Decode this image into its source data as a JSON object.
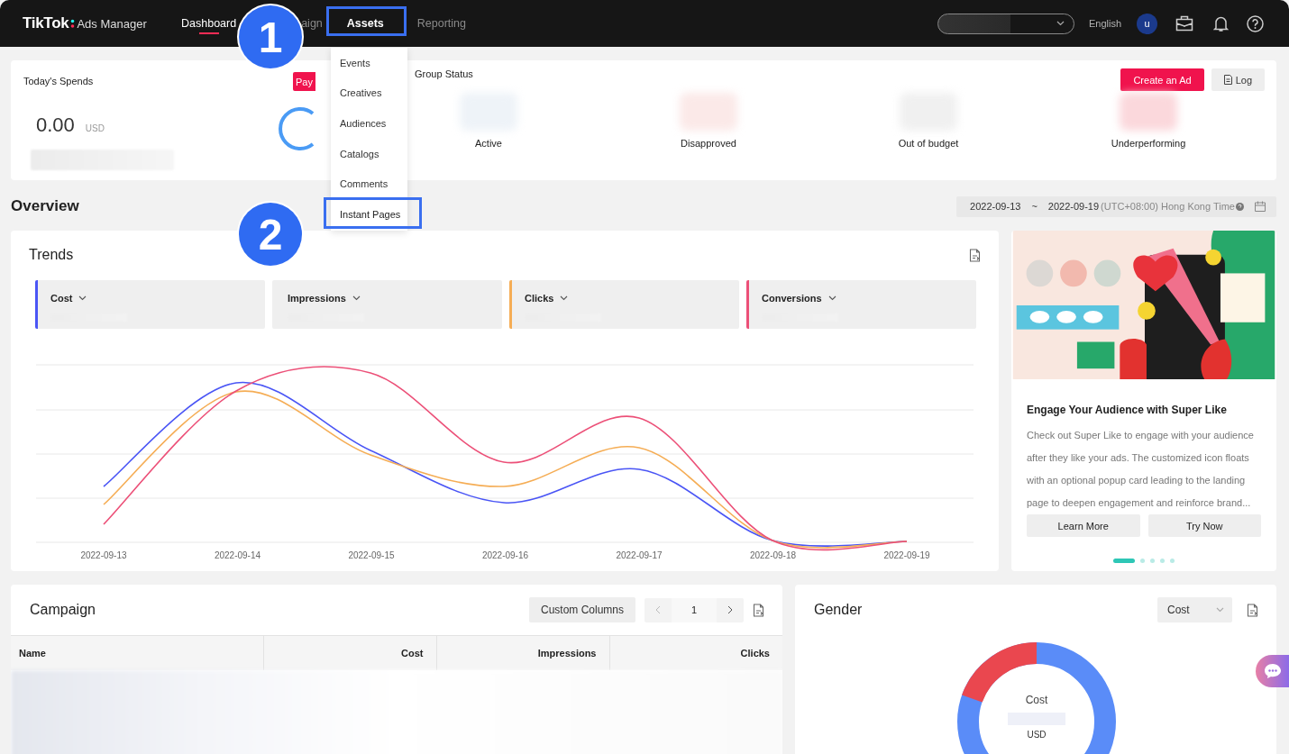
{
  "header": {
    "logo": "TikTok",
    "product": "Ads Manager",
    "nav": [
      {
        "label": "Dashboard",
        "selected": true,
        "open": false
      },
      {
        "label": "aign",
        "selected": false,
        "open": false
      },
      {
        "label": "Assets",
        "selected": false,
        "open": true
      },
      {
        "label": "Reporting",
        "selected": false,
        "open": false
      }
    ],
    "language": "English",
    "avatar": "u"
  },
  "assets_menu": {
    "items": [
      {
        "label": "Events",
        "highlighted": false
      },
      {
        "label": "Creatives",
        "highlighted": false
      },
      {
        "label": "Audiences",
        "highlighted": false
      },
      {
        "label": "Catalogs",
        "highlighted": false
      },
      {
        "label": "Comments",
        "highlighted": false
      },
      {
        "label": "Instant Pages",
        "highlighted": true
      }
    ]
  },
  "guide_markers": [
    "1",
    "2"
  ],
  "spends": {
    "title": "Today's Spends",
    "amount": "0.00",
    "currency": "USD",
    "pay_button": "Pay"
  },
  "ad_group_status": {
    "title": "Group Status",
    "statuses": [
      "Active",
      "Disapproved",
      "Out of budget",
      "Underperforming"
    ],
    "create_button": "Create an Ad",
    "log_button": "Log"
  },
  "overview": {
    "title": "Overview",
    "start_date": "2022-09-13",
    "separator": "~",
    "end_date": "2022-09-19",
    "timezone": "(UTC+08:00) Hong Kong Time"
  },
  "trends": {
    "title": "Trends",
    "metrics": [
      {
        "label": "Cost",
        "color": "#4a55f5"
      },
      {
        "label": "Impressions"
      },
      {
        "label": "Clicks",
        "color": "#f5ad55"
      },
      {
        "label": "Conversions",
        "color": "#ec5078"
      }
    ],
    "x_labels": [
      "2022-09-13",
      "2022-09-14",
      "2022-09-15",
      "2022-09-16",
      "2022-09-17",
      "2022-09-18",
      "2022-09-19"
    ]
  },
  "promo": {
    "title": "Engage Your Audience with Super Like",
    "body": "Check out Super Like to engage with your audience after they like your ads. The customized icon floats with an optional popup card leading to the landing page to deepen engagement and reinforce brand...",
    "buttons": [
      "Learn More",
      "Try Now"
    ],
    "dots": [
      {
        "selected": true
      },
      {
        "selected": false
      },
      {
        "selected": false
      },
      {
        "selected": false
      },
      {
        "selected": false
      }
    ]
  },
  "campaign": {
    "title": "Campaign",
    "custom_columns": "Custom Columns",
    "page": "1",
    "columns": [
      "Name",
      "Cost",
      "Impressions",
      "Clicks"
    ]
  },
  "gender": {
    "title": "Gender",
    "metric_select": "Cost",
    "center_label": "Cost",
    "center_unit": "USD"
  }
}
